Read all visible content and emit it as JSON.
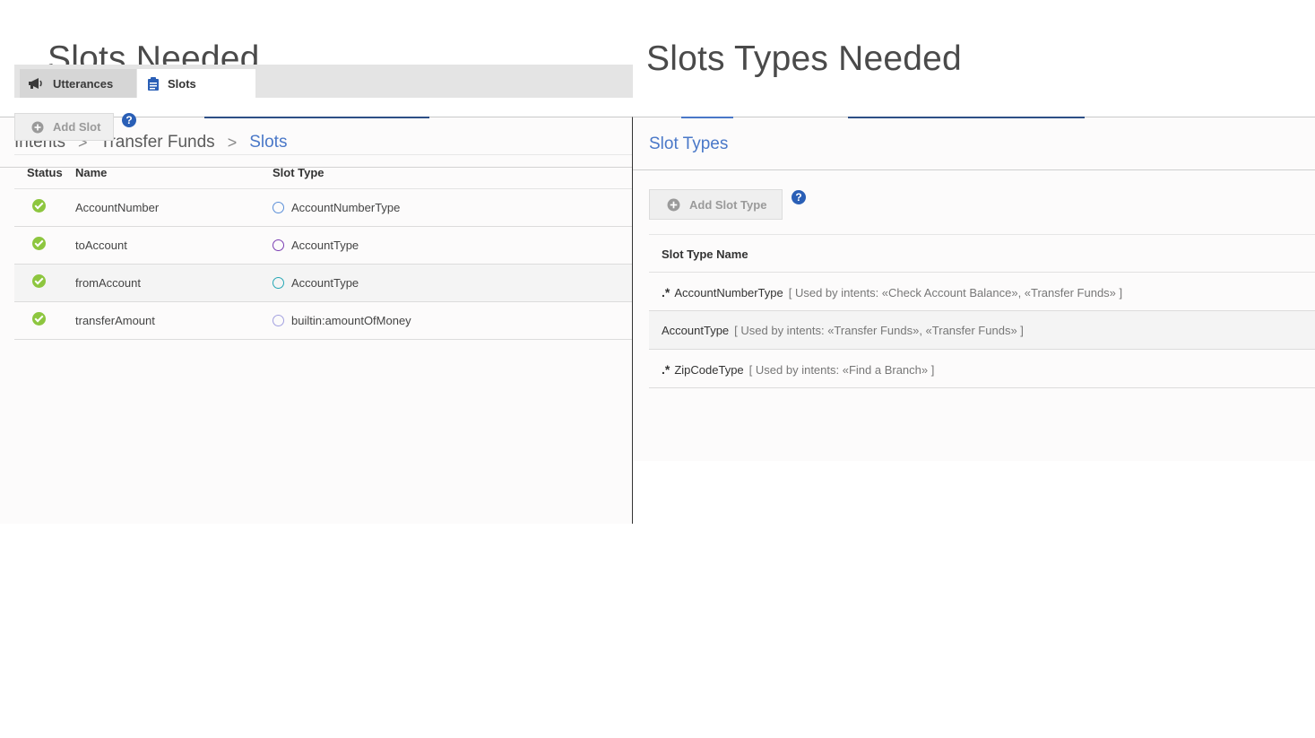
{
  "slide": {
    "left_title": "Slots Needed",
    "right_title": "Slots Types Needed"
  },
  "left": {
    "breadcrumb": [
      "Intents",
      "Transfer Funds",
      "Slots"
    ],
    "tabs": [
      {
        "label": "Utterances",
        "icon": "megaphone-icon"
      },
      {
        "label": "Slots",
        "icon": "clipboard-icon"
      }
    ],
    "add_button": "Add Slot",
    "help": "?",
    "columns": [
      "Status",
      "Name",
      "Slot Type"
    ],
    "rows": [
      {
        "name": "AccountNumber",
        "type": "AccountNumberType",
        "circle_color": "#5b8fd8"
      },
      {
        "name": "toAccount",
        "type": "AccountType",
        "circle_color": "#7b3fb3"
      },
      {
        "name": "fromAccount",
        "type": "AccountType",
        "circle_color": "#26a7b5"
      },
      {
        "name": "transferAmount",
        "type": "builtin:amountOfMoney",
        "circle_color": "#a3a1e0"
      }
    ]
  },
  "right": {
    "title": "Slot Types",
    "add_button": "Add Slot Type",
    "help": "?",
    "column": "Slot Type Name",
    "rows": [
      {
        "icon": ".*",
        "name": "AccountNumberType",
        "used_by": "[ Used by intents: «Check Account Balance», «Transfer Funds» ]"
      },
      {
        "icon": "",
        "name": "AccountType",
        "used_by": "[ Used by intents: «Transfer Funds», «Transfer Funds» ]"
      },
      {
        "icon": ".*",
        "name": "ZipCodeType",
        "used_by": "[ Used by intents: «Find a Branch» ]"
      }
    ]
  },
  "colors": {
    "accent": "#4a78c8",
    "status_ok": "#8dc63f",
    "help": "#2a5fb6"
  }
}
